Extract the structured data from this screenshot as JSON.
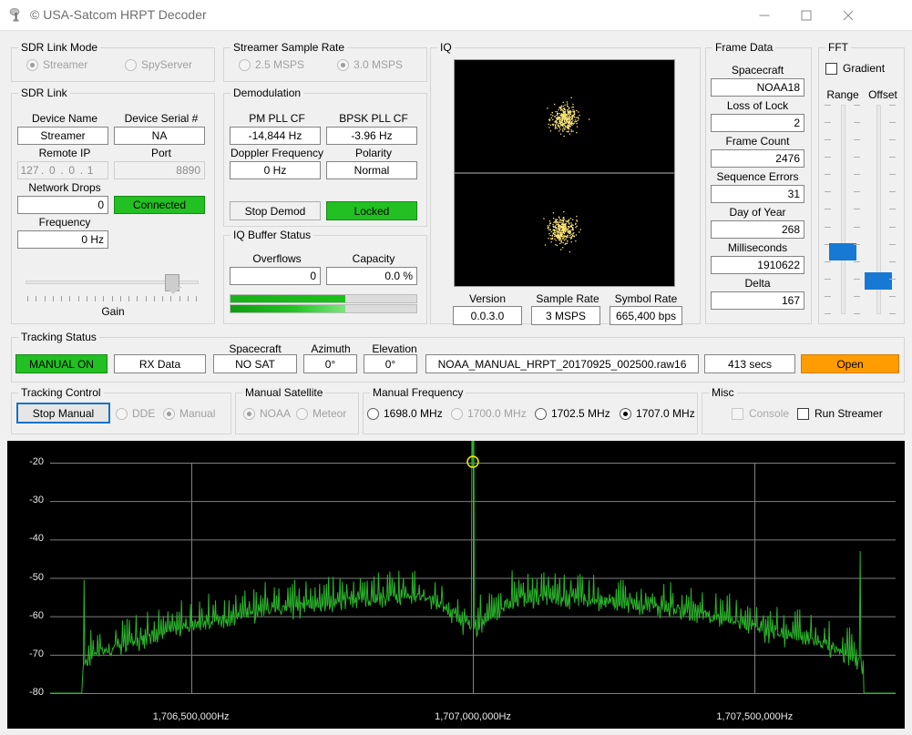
{
  "window": {
    "title": "© USA-Satcom HRPT Decoder",
    "minimize": "minimize-icon",
    "maximize": "maximize-icon",
    "close": "close-icon"
  },
  "sdr_link_mode": {
    "caption": "SDR Link Mode",
    "options": [
      {
        "label": "Streamer",
        "selected": true,
        "disabled": true
      },
      {
        "label": "SpyServer",
        "selected": false,
        "disabled": true
      }
    ]
  },
  "sdr_link": {
    "caption": "SDR Link",
    "device_name_label": "Device Name",
    "device_name_value": "Streamer",
    "device_serial_label": "Device Serial #",
    "device_serial_value": "NA",
    "remote_ip_label": "Remote IP",
    "remote_ip_octets": [
      "127",
      "0",
      "0",
      "1"
    ],
    "port_label": "Port",
    "port_value": "8890",
    "network_drops_label": "Network Drops",
    "network_drops_value": "0",
    "connect_status": "Connected",
    "frequency_label": "Frequency",
    "frequency_value": "0 Hz",
    "gain_label": "Gain",
    "gain_percent": 88
  },
  "streamer_sample_rate": {
    "caption": "Streamer Sample Rate",
    "options": [
      {
        "label": "2.5 MSPS",
        "selected": false,
        "disabled": true
      },
      {
        "label": "3.0 MSPS",
        "selected": true,
        "disabled": true
      }
    ]
  },
  "demodulation": {
    "caption": "Demodulation",
    "pm_pll_cf_label": "PM PLL CF",
    "pm_pll_cf_value": "-14,844 Hz",
    "bpsk_pll_cf_label": "BPSK PLL CF",
    "bpsk_pll_cf_value": "-3.96 Hz",
    "doppler_label": "Doppler Frequency",
    "doppler_value": "0 Hz",
    "polarity_label": "Polarity",
    "polarity_value": "Normal",
    "stop_demod_label": "Stop Demod",
    "lock_status": "Locked"
  },
  "iq_buffer": {
    "caption": "IQ Buffer Status",
    "overflows_label": "Overflows",
    "overflows_value": "0",
    "capacity_label": "Capacity",
    "capacity_value": "0.0 %",
    "bar1_percent": 62,
    "bar2_percent": 62
  },
  "iq": {
    "caption": "IQ",
    "version_label": "Version",
    "version_value": "0.0.3.0",
    "sample_rate_label": "Sample Rate",
    "sample_rate_value": "3 MSPS",
    "symbol_rate_label": "Symbol Rate",
    "symbol_rate_value": "665,400 bps",
    "point_color": "#ffe97a",
    "background": "#000000"
  },
  "frame_data": {
    "caption": "Frame Data",
    "fields": [
      {
        "label": "Spacecraft",
        "value": "NOAA18"
      },
      {
        "label": "Loss of Lock",
        "value": "2"
      },
      {
        "label": "Frame Count",
        "value": "2476"
      },
      {
        "label": "Sequence Errors",
        "value": "31"
      },
      {
        "label": "Day of Year",
        "value": "268"
      },
      {
        "label": "Milliseconds",
        "value": "1910622"
      },
      {
        "label": "Delta",
        "value": "167"
      }
    ]
  },
  "fft": {
    "caption": "FFT",
    "gradient_label": "Gradient",
    "gradient_checked": false,
    "range_label": "Range",
    "offset_label": "Offset",
    "range_percent": 28,
    "offset_percent": 13,
    "thumb_color": "#1779d3"
  },
  "tracking_status": {
    "caption": "Tracking Status",
    "mode_status": "MANUAL ON",
    "rx_data": "RX Data",
    "spacecraft_label": "Spacecraft",
    "spacecraft_value": "NO SAT",
    "azimuth_label": "Azimuth",
    "azimuth_value": "0°",
    "elevation_label": "Elevation",
    "elevation_value": "0°",
    "filename": "NOAA_MANUAL_HRPT_20170925_002500.raw16",
    "elapsed": "413 secs",
    "open_button": "Open"
  },
  "tracking_control": {
    "caption": "Tracking Control",
    "stop_manual": "Stop Manual",
    "options": [
      {
        "label": "DDE",
        "selected": false,
        "disabled": true
      },
      {
        "label": "Manual",
        "selected": true,
        "disabled": true
      }
    ]
  },
  "manual_satellite": {
    "caption": "Manual Satellite",
    "options": [
      {
        "label": "NOAA",
        "selected": true,
        "disabled": true
      },
      {
        "label": "Meteor",
        "selected": false,
        "disabled": true
      }
    ]
  },
  "manual_frequency": {
    "caption": "Manual Frequency",
    "options": [
      {
        "label": "1698.0 MHz",
        "selected": false,
        "disabled": false
      },
      {
        "label": "1700.0 MHz",
        "selected": false,
        "disabled": true
      },
      {
        "label": "1702.5 MHz",
        "selected": false,
        "disabled": false
      },
      {
        "label": "1707.0 MHz",
        "selected": true,
        "disabled": false
      }
    ]
  },
  "misc": {
    "caption": "Misc",
    "console_label": "Console",
    "console_checked": false,
    "console_disabled": true,
    "run_streamer_label": "Run Streamer",
    "run_streamer_checked": false
  },
  "chart_data": {
    "type": "line",
    "title": "",
    "xlabel": "",
    "ylabel": "",
    "trace_color": "#2bb32b",
    "background": "#000000",
    "grid": true,
    "grid_color": "#808080",
    "marker_color": "#e8e800",
    "ylim": [
      -80,
      -20
    ],
    "yticks": [
      -20,
      -30,
      -40,
      -50,
      -60,
      -70,
      -80
    ],
    "xlim": [
      1706250000,
      1707750000
    ],
    "xticks": [
      1706500000,
      1707000000,
      1707500000
    ],
    "xticklabels": [
      "1,706,500,000Hz",
      "1,707,000,000Hz",
      "1,707,500,000Hz"
    ],
    "peak_marker": {
      "x": 1707000000,
      "y": -21.2,
      "label": ""
    },
    "notes": "HRPT downlink spectrum, carrier peak at 1707 MHz, noise floor humped between -72 and -55 dB",
    "series": [
      {
        "name": "FFT",
        "description": "flat baseline at -80 dB on both outer edges, narrow edge spikes, broad hump with dense comb lines, tall center carrier",
        "baseline_db": -80,
        "hump_peak_db": -55,
        "carrier_db": -21.2
      }
    ]
  }
}
